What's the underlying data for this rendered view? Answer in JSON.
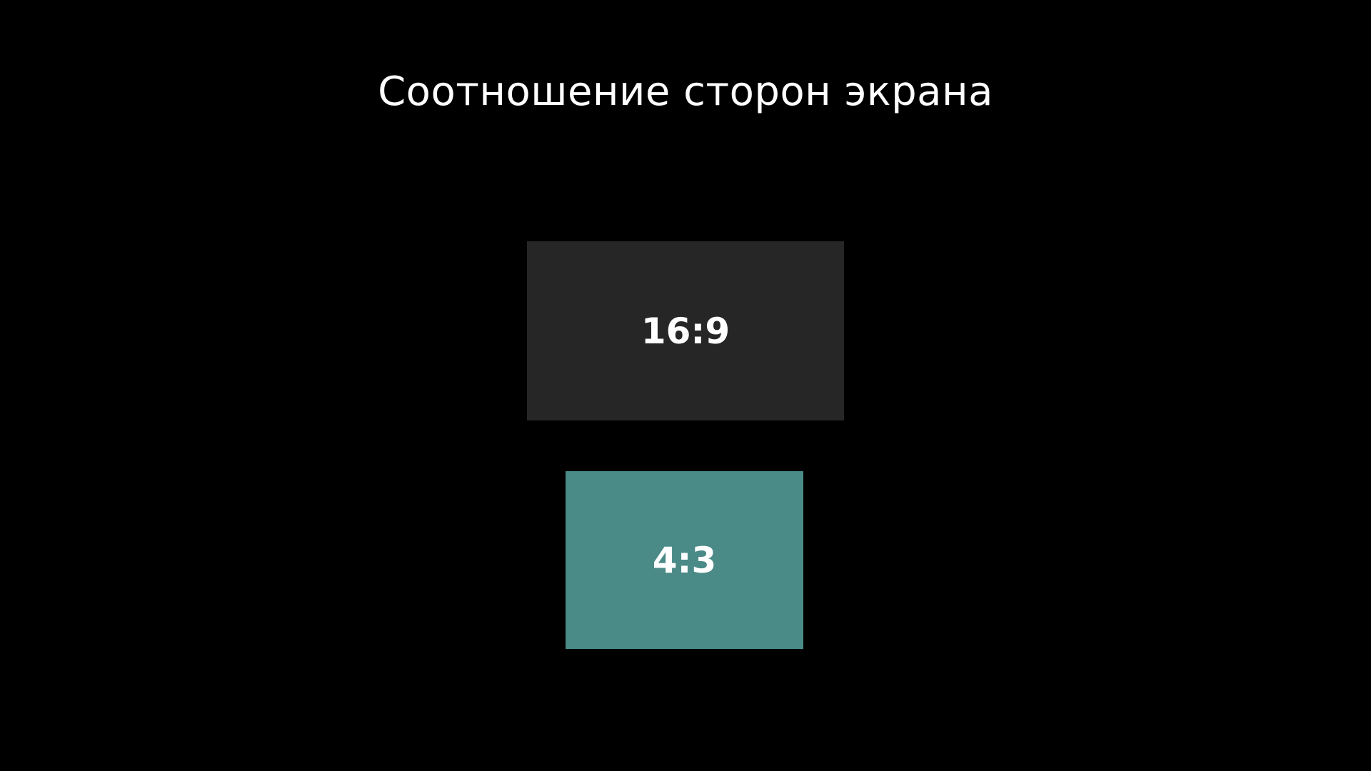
{
  "screen": {
    "title": "Соотношение сторон экрана"
  },
  "options": [
    {
      "label": "16:9",
      "selected": false,
      "color": "#262626"
    },
    {
      "label": "4:3",
      "selected": true,
      "color": "#4a8a87"
    }
  ],
  "colors": {
    "background": "#000000",
    "text": "#ffffff"
  }
}
